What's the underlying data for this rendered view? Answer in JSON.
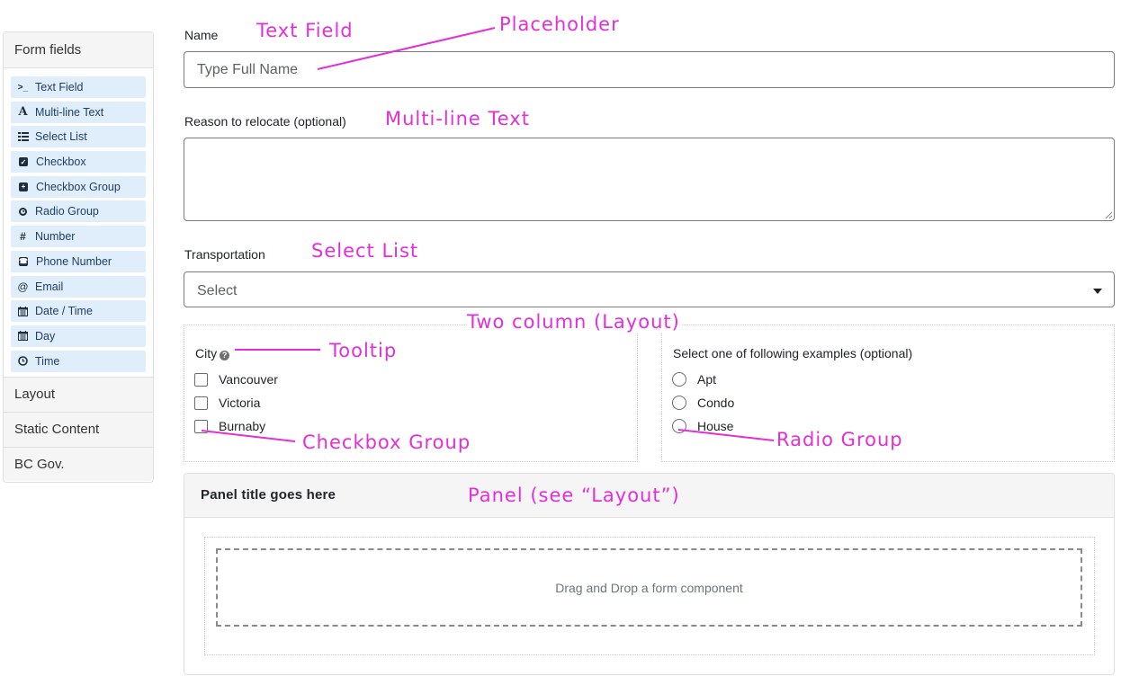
{
  "sidebar": {
    "title": "Form fields",
    "items": [
      {
        "label": "Text Field",
        "icon": "terminal-icon"
      },
      {
        "label": "Multi-line Text",
        "icon": "font-icon"
      },
      {
        "label": "Select List",
        "icon": "list-icon"
      },
      {
        "label": "Checkbox",
        "icon": "check-square-icon"
      },
      {
        "label": "Checkbox Group",
        "icon": "plus-square-icon"
      },
      {
        "label": "Radio Group",
        "icon": "dot-circle-icon"
      },
      {
        "label": "Number",
        "icon": "hashtag-icon"
      },
      {
        "label": "Phone Number",
        "icon": "phone-square-icon"
      },
      {
        "label": "Email",
        "icon": "at-icon"
      },
      {
        "label": "Date / Time",
        "icon": "calendar-icon"
      },
      {
        "label": "Day",
        "icon": "calendar-icon"
      },
      {
        "label": "Time",
        "icon": "clock-icon"
      }
    ],
    "sections": [
      "Layout",
      "Static Content",
      "BC Gov."
    ]
  },
  "form": {
    "name": {
      "label": "Name",
      "placeholder": "Type Full Name"
    },
    "reason": {
      "label": "Reason to relocate (optional)",
      "value": ""
    },
    "transportation": {
      "label": "Transportation",
      "selected": "Select"
    },
    "city": {
      "label": "City",
      "options": [
        "Vancouver",
        "Victoria",
        "Burnaby"
      ]
    },
    "examples": {
      "label": "Select one of following examples (optional)",
      "options": [
        "Apt",
        "Condo",
        "House"
      ]
    },
    "panel": {
      "title": "Panel title goes here",
      "dropzone": "Drag and Drop a form component"
    }
  },
  "annotations": {
    "text_field": "Text Field",
    "placeholder": "Placeholder",
    "multiline": "Multi-line Text",
    "select_list": "Select List",
    "two_column": "Two column (Layout)",
    "tooltip": "Tooltip",
    "checkbox_group": "Checkbox Group",
    "radio_group": "Radio Group",
    "panel": "Panel (see “Layout”)"
  },
  "colors": {
    "annotation": "#e22fd8",
    "sidebar_item_bg": "#e0edfa",
    "sidebar_item_text": "#1e3f66"
  }
}
